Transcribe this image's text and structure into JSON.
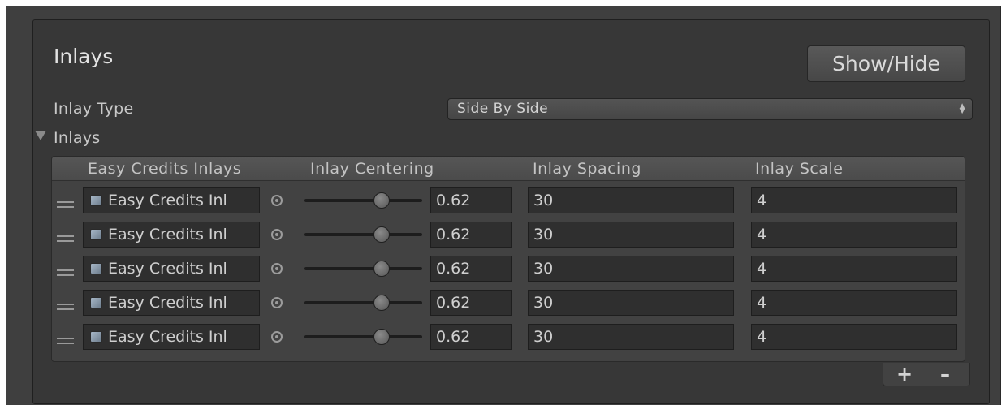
{
  "section": {
    "title": "Inlays",
    "show_hide_label": "Show/Hide"
  },
  "inlay_type": {
    "label": "Inlay Type",
    "value": "Side By Side"
  },
  "inlays_foldout": {
    "label": "Inlays"
  },
  "table": {
    "headers": [
      "Easy Credits Inlays",
      "Inlay Centering",
      "Inlay Spacing",
      "Inlay Scale"
    ],
    "rows": [
      {
        "object": "Easy Credits Inl",
        "centering": "0.62",
        "slider_fraction": 0.62,
        "spacing": "30",
        "scale": "4"
      },
      {
        "object": "Easy Credits Inl",
        "centering": "0.62",
        "slider_fraction": 0.62,
        "spacing": "30",
        "scale": "4"
      },
      {
        "object": "Easy Credits Inl",
        "centering": "0.62",
        "slider_fraction": 0.62,
        "spacing": "30",
        "scale": "4"
      },
      {
        "object": "Easy Credits Inl",
        "centering": "0.62",
        "slider_fraction": 0.62,
        "spacing": "30",
        "scale": "4"
      },
      {
        "object": "Easy Credits Inl",
        "centering": "0.62",
        "slider_fraction": 0.62,
        "spacing": "30",
        "scale": "4"
      }
    ]
  },
  "footer": {
    "add_label": "+",
    "remove_label": "–"
  },
  "icons": {
    "foldout": "triangle-down-icon",
    "drag": "drag-handle-icon",
    "object": "prefab-icon",
    "picker": "object-picker-icon",
    "dropdown": "up-down-arrows-icon"
  }
}
